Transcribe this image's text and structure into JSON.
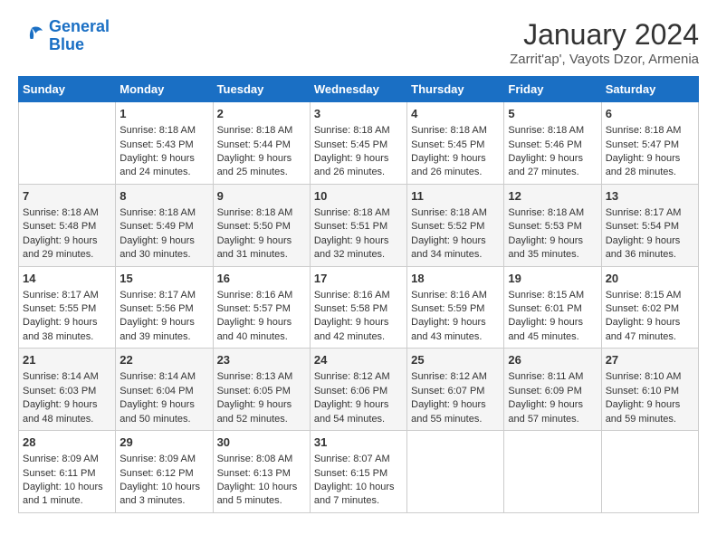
{
  "logo": {
    "line1": "General",
    "line2": "Blue"
  },
  "title": "January 2024",
  "subtitle": "Zarrit'ap', Vayots Dzor, Armenia",
  "days_of_week": [
    "Sunday",
    "Monday",
    "Tuesday",
    "Wednesday",
    "Thursday",
    "Friday",
    "Saturday"
  ],
  "weeks": [
    [
      {
        "day": "",
        "sunrise": "",
        "sunset": "",
        "daylight": ""
      },
      {
        "day": "1",
        "sunrise": "Sunrise: 8:18 AM",
        "sunset": "Sunset: 5:43 PM",
        "daylight": "Daylight: 9 hours and 24 minutes."
      },
      {
        "day": "2",
        "sunrise": "Sunrise: 8:18 AM",
        "sunset": "Sunset: 5:44 PM",
        "daylight": "Daylight: 9 hours and 25 minutes."
      },
      {
        "day": "3",
        "sunrise": "Sunrise: 8:18 AM",
        "sunset": "Sunset: 5:45 PM",
        "daylight": "Daylight: 9 hours and 26 minutes."
      },
      {
        "day": "4",
        "sunrise": "Sunrise: 8:18 AM",
        "sunset": "Sunset: 5:45 PM",
        "daylight": "Daylight: 9 hours and 26 minutes."
      },
      {
        "day": "5",
        "sunrise": "Sunrise: 8:18 AM",
        "sunset": "Sunset: 5:46 PM",
        "daylight": "Daylight: 9 hours and 27 minutes."
      },
      {
        "day": "6",
        "sunrise": "Sunrise: 8:18 AM",
        "sunset": "Sunset: 5:47 PM",
        "daylight": "Daylight: 9 hours and 28 minutes."
      }
    ],
    [
      {
        "day": "7",
        "sunrise": "Sunrise: 8:18 AM",
        "sunset": "Sunset: 5:48 PM",
        "daylight": "Daylight: 9 hours and 29 minutes."
      },
      {
        "day": "8",
        "sunrise": "Sunrise: 8:18 AM",
        "sunset": "Sunset: 5:49 PM",
        "daylight": "Daylight: 9 hours and 30 minutes."
      },
      {
        "day": "9",
        "sunrise": "Sunrise: 8:18 AM",
        "sunset": "Sunset: 5:50 PM",
        "daylight": "Daylight: 9 hours and 31 minutes."
      },
      {
        "day": "10",
        "sunrise": "Sunrise: 8:18 AM",
        "sunset": "Sunset: 5:51 PM",
        "daylight": "Daylight: 9 hours and 32 minutes."
      },
      {
        "day": "11",
        "sunrise": "Sunrise: 8:18 AM",
        "sunset": "Sunset: 5:52 PM",
        "daylight": "Daylight: 9 hours and 34 minutes."
      },
      {
        "day": "12",
        "sunrise": "Sunrise: 8:18 AM",
        "sunset": "Sunset: 5:53 PM",
        "daylight": "Daylight: 9 hours and 35 minutes."
      },
      {
        "day": "13",
        "sunrise": "Sunrise: 8:17 AM",
        "sunset": "Sunset: 5:54 PM",
        "daylight": "Daylight: 9 hours and 36 minutes."
      }
    ],
    [
      {
        "day": "14",
        "sunrise": "Sunrise: 8:17 AM",
        "sunset": "Sunset: 5:55 PM",
        "daylight": "Daylight: 9 hours and 38 minutes."
      },
      {
        "day": "15",
        "sunrise": "Sunrise: 8:17 AM",
        "sunset": "Sunset: 5:56 PM",
        "daylight": "Daylight: 9 hours and 39 minutes."
      },
      {
        "day": "16",
        "sunrise": "Sunrise: 8:16 AM",
        "sunset": "Sunset: 5:57 PM",
        "daylight": "Daylight: 9 hours and 40 minutes."
      },
      {
        "day": "17",
        "sunrise": "Sunrise: 8:16 AM",
        "sunset": "Sunset: 5:58 PM",
        "daylight": "Daylight: 9 hours and 42 minutes."
      },
      {
        "day": "18",
        "sunrise": "Sunrise: 8:16 AM",
        "sunset": "Sunset: 5:59 PM",
        "daylight": "Daylight: 9 hours and 43 minutes."
      },
      {
        "day": "19",
        "sunrise": "Sunrise: 8:15 AM",
        "sunset": "Sunset: 6:01 PM",
        "daylight": "Daylight: 9 hours and 45 minutes."
      },
      {
        "day": "20",
        "sunrise": "Sunrise: 8:15 AM",
        "sunset": "Sunset: 6:02 PM",
        "daylight": "Daylight: 9 hours and 47 minutes."
      }
    ],
    [
      {
        "day": "21",
        "sunrise": "Sunrise: 8:14 AM",
        "sunset": "Sunset: 6:03 PM",
        "daylight": "Daylight: 9 hours and 48 minutes."
      },
      {
        "day": "22",
        "sunrise": "Sunrise: 8:14 AM",
        "sunset": "Sunset: 6:04 PM",
        "daylight": "Daylight: 9 hours and 50 minutes."
      },
      {
        "day": "23",
        "sunrise": "Sunrise: 8:13 AM",
        "sunset": "Sunset: 6:05 PM",
        "daylight": "Daylight: 9 hours and 52 minutes."
      },
      {
        "day": "24",
        "sunrise": "Sunrise: 8:12 AM",
        "sunset": "Sunset: 6:06 PM",
        "daylight": "Daylight: 9 hours and 54 minutes."
      },
      {
        "day": "25",
        "sunrise": "Sunrise: 8:12 AM",
        "sunset": "Sunset: 6:07 PM",
        "daylight": "Daylight: 9 hours and 55 minutes."
      },
      {
        "day": "26",
        "sunrise": "Sunrise: 8:11 AM",
        "sunset": "Sunset: 6:09 PM",
        "daylight": "Daylight: 9 hours and 57 minutes."
      },
      {
        "day": "27",
        "sunrise": "Sunrise: 8:10 AM",
        "sunset": "Sunset: 6:10 PM",
        "daylight": "Daylight: 9 hours and 59 minutes."
      }
    ],
    [
      {
        "day": "28",
        "sunrise": "Sunrise: 8:09 AM",
        "sunset": "Sunset: 6:11 PM",
        "daylight": "Daylight: 10 hours and 1 minute."
      },
      {
        "day": "29",
        "sunrise": "Sunrise: 8:09 AM",
        "sunset": "Sunset: 6:12 PM",
        "daylight": "Daylight: 10 hours and 3 minutes."
      },
      {
        "day": "30",
        "sunrise": "Sunrise: 8:08 AM",
        "sunset": "Sunset: 6:13 PM",
        "daylight": "Daylight: 10 hours and 5 minutes."
      },
      {
        "day": "31",
        "sunrise": "Sunrise: 8:07 AM",
        "sunset": "Sunset: 6:15 PM",
        "daylight": "Daylight: 10 hours and 7 minutes."
      },
      {
        "day": "",
        "sunrise": "",
        "sunset": "",
        "daylight": ""
      },
      {
        "day": "",
        "sunrise": "",
        "sunset": "",
        "daylight": ""
      },
      {
        "day": "",
        "sunrise": "",
        "sunset": "",
        "daylight": ""
      }
    ]
  ]
}
